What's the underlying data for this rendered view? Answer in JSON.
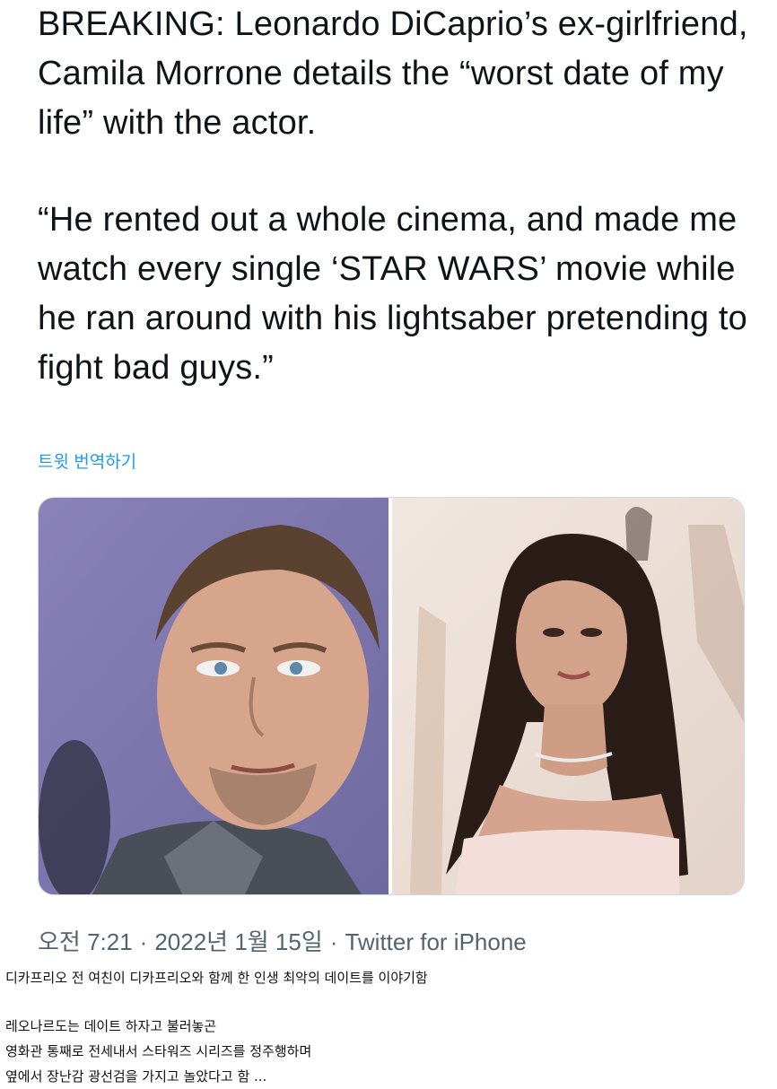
{
  "tweet": {
    "headline": "BREAKING: Leonardo DiCaprio’s ex-girlfriend, Camila Morrone details the “worst date of my life” with the actor.",
    "quote": "“He rented out a whole cinema, and made me watch every single ‘STAR WARS’ movie while he ran around with his lightsaber pretending to fight bad guys.”",
    "translate_label": "트윗 번역하기",
    "time": "오전 7:21",
    "date": "2022년 1월 15일",
    "source": "Twitter for iPhone",
    "separator": "·"
  },
  "media": {
    "left_photo": "man-portrait",
    "right_photo": "woman-portrait"
  },
  "comment": {
    "line1": "디카프리오 전 여친이 디카프리오와 함께 한 인생 최악의 데이트를 이야기함",
    "line2": "레오나르도는 데이트 하자고 불러놓곤",
    "line3": "영화관 통째로 전세내서 스타워즈 시리즈를 정주행하며",
    "line4": "옆에서 장난감 광선검을 가지고 놀았다고 함 ..."
  },
  "colors": {
    "link": "#1d9bf0",
    "meta_text": "#536471",
    "text": "#0f1419"
  }
}
